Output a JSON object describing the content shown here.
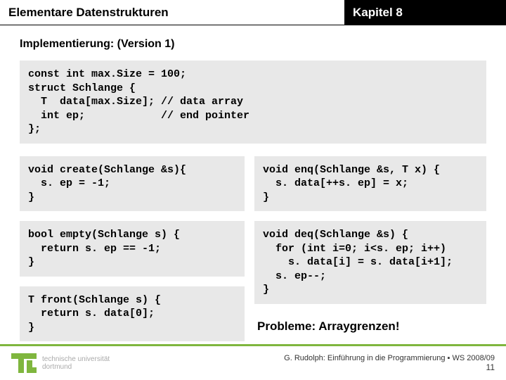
{
  "header": {
    "left": "Elementare Datenstrukturen",
    "right": "Kapitel 8"
  },
  "subtitle": "Implementierung: (Version 1)",
  "code": {
    "struct": "const int max.Size = 100;\nstruct Schlange {\n  T  data[max.Size]; // data array\n  int ep;            // end pointer\n};",
    "create": "void create(Schlange &s){\n  s. ep = -1;\n}",
    "empty": "bool empty(Schlange s) {\n  return s. ep == -1;\n}",
    "front": "T front(Schlange s) {\n  return s. data[0];\n}",
    "enq": "void enq(Schlange &s, T x) {\n  s. data[++s. ep] = x;\n}",
    "deq": "void deq(Schlange &s) {\n  for (int i=0; i<s. ep; i++)\n    s. data[i] = s. data[i+1];\n  s. ep--;\n}"
  },
  "problems": "Probleme: Arraygrenzen!",
  "footer": {
    "uni1": "technische universität",
    "uni2": "dortmund",
    "credit": "G. Rudolph: Einführung in die Programmierung ▪ WS 2008/09",
    "page": "11"
  }
}
